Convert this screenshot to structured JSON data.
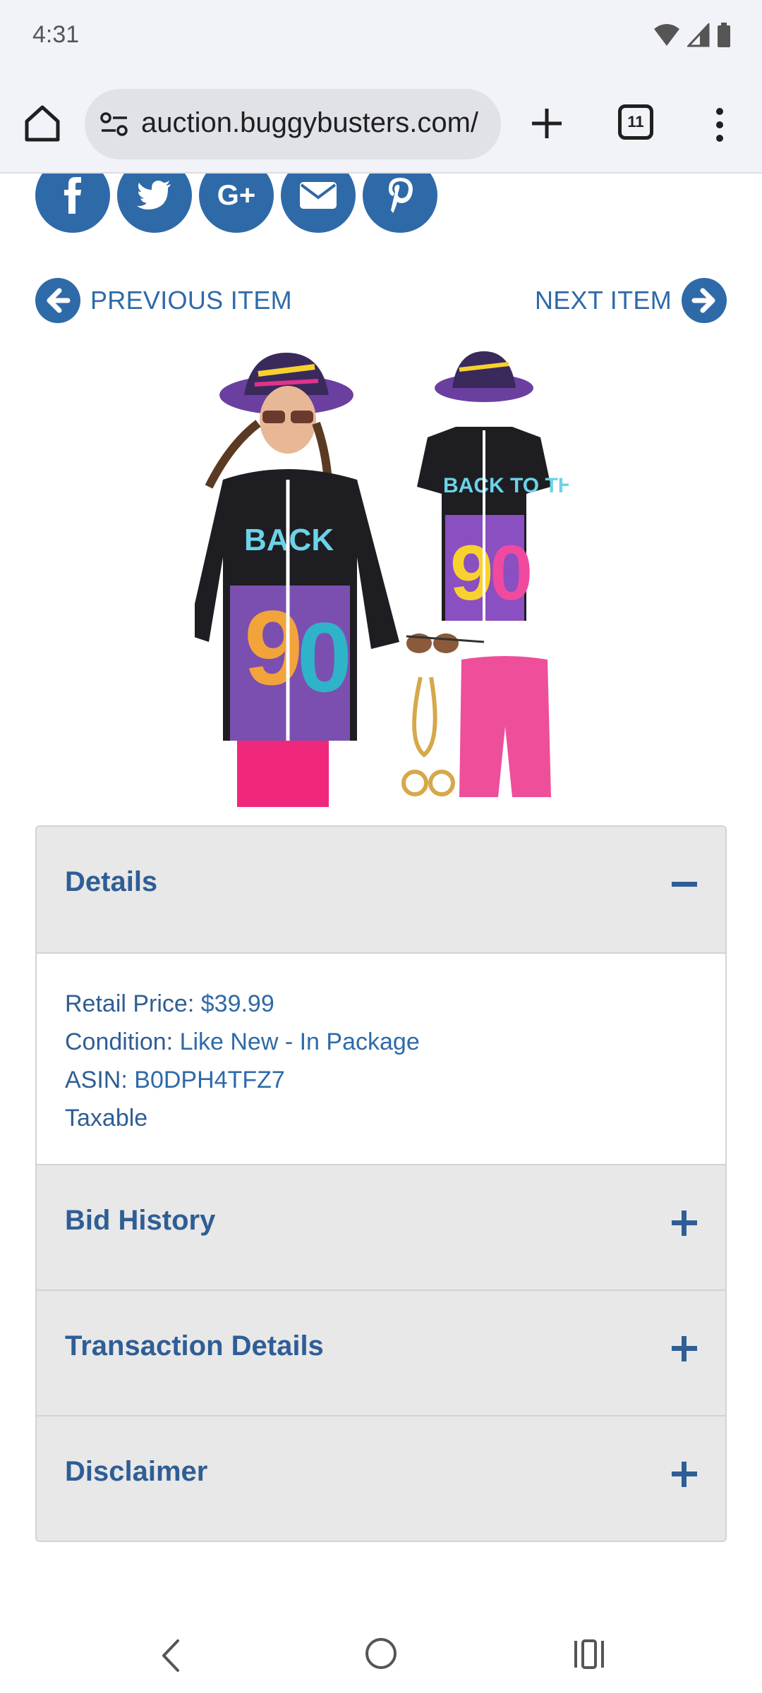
{
  "status_bar": {
    "time": "4:31"
  },
  "browser": {
    "url": "auction.buggybusters.com/",
    "tab_count": "11"
  },
  "share_icons": [
    {
      "name": "facebook-icon",
      "glyph": "f"
    },
    {
      "name": "twitter-icon",
      "glyph": ""
    },
    {
      "name": "google-plus-icon",
      "glyph": "G+"
    },
    {
      "name": "email-icon",
      "glyph": ""
    },
    {
      "name": "pinterest-icon",
      "glyph": "P"
    }
  ],
  "nav": {
    "previous_label": "PREVIOUS ITEM",
    "next_label": "NEXT ITEM"
  },
  "accordion": {
    "details": {
      "title": "Details",
      "retail_price_label": "Retail Price",
      "retail_price_value": "$39.99",
      "condition_label": "Condition",
      "condition_value": "Like New - In Package",
      "asin_label": "ASIN",
      "asin_value": "B0DPH4TFZ7",
      "taxable_label": "Taxable"
    },
    "bid_history": {
      "title": "Bid History"
    },
    "transaction_details": {
      "title": "Transaction Details"
    },
    "disclaimer": {
      "title": "Disclaimer"
    }
  },
  "colors": {
    "accent": "#2f6aa8",
    "heading": "#2f5e95",
    "panel": "#e8e8e8"
  }
}
